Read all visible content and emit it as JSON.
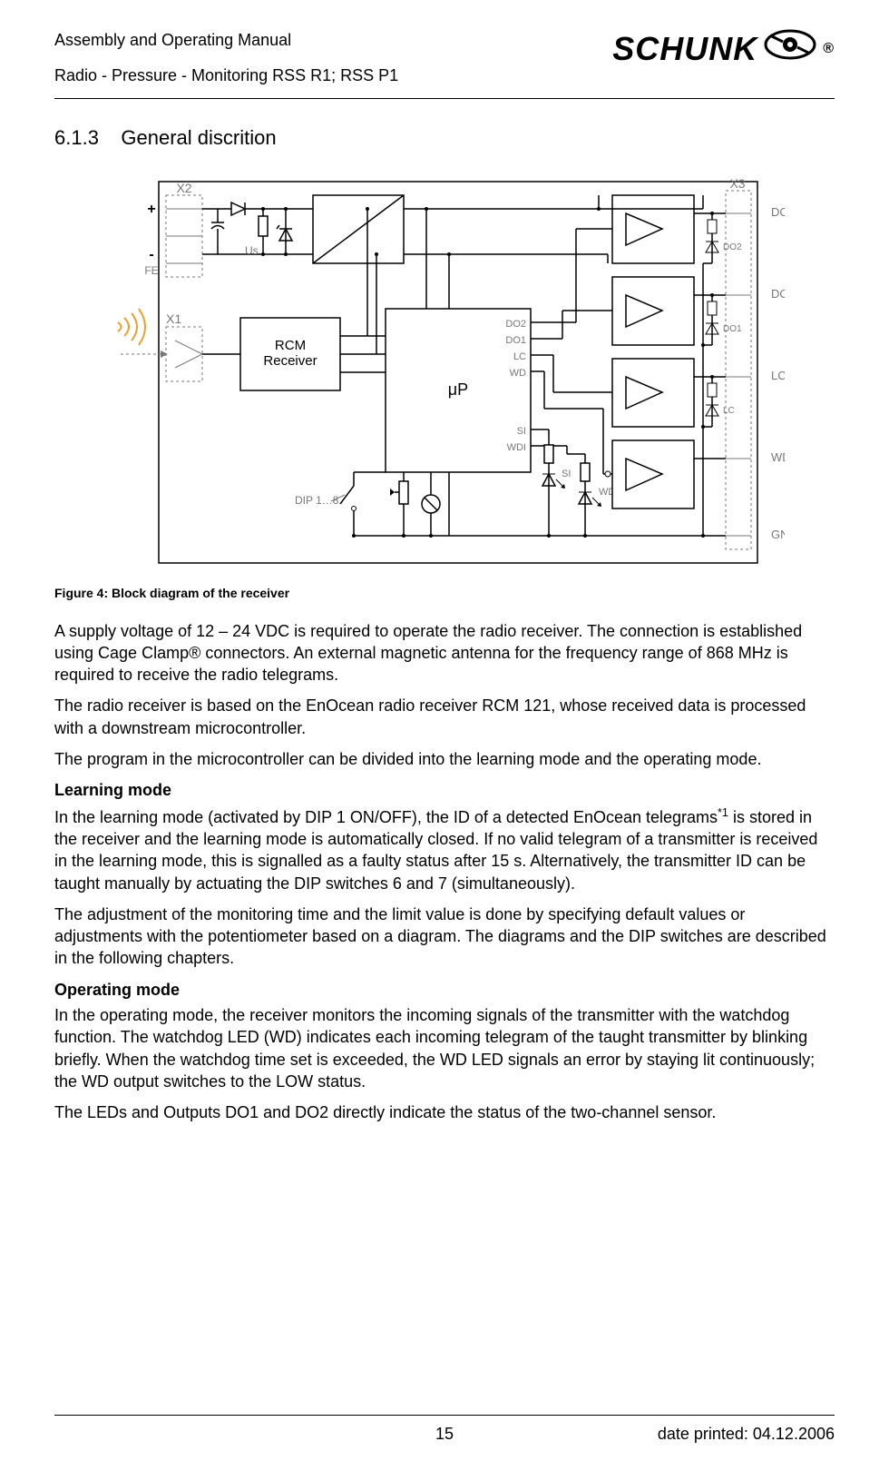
{
  "header": {
    "manual_title": "Assembly and Operating Manual",
    "product_line": "Radio - Pressure - Monitoring RSS R1; RSS P1",
    "brand": "SCHUNK",
    "trademark": "®"
  },
  "section": {
    "number": "6.1.3",
    "title": "General discrition"
  },
  "figure": {
    "caption": "Figure 4: Block diagram of the receiver",
    "labels": {
      "x2": "X2",
      "plus": "+",
      "minus": "-",
      "fe": "FE",
      "x1": "X1",
      "us": "Us",
      "rcm": "RCM",
      "receiver": "Receiver",
      "up": "μP",
      "do2": "DO2",
      "do1": "DO1",
      "lc": "LC",
      "wd": "WD",
      "si": "SI",
      "wdi": "WDI",
      "dip": "DIP 1…8",
      "x3": "X3",
      "gnd": "GND"
    }
  },
  "body": {
    "p1": "A supply voltage of 12 – 24 VDC is required to operate the radio receiver. The connection is established using Cage Clamp® connectors. An external magnetic antenna for the frequency range of 868 MHz is required to receive the radio telegrams.",
    "p2": "The radio receiver is based on the EnOcean radio receiver RCM 121, whose received data is processed with a downstream microcontroller.",
    "p3": "The program in the microcontroller can be divided into the learning mode and the operating mode.",
    "h1": "Learning mode",
    "p4a": "In the learning mode (activated by DIP 1 ON/OFF), the ID of a detected EnOcean telegrams",
    "p4sup": "*1",
    "p4b": " is stored in the receiver and the learning mode is automatically closed. If no valid telegram of a transmitter is received in the learning mode, this is signalled as a faulty status after 15 s. Alternatively, the transmitter ID can be taught manually by actuating the DIP switches 6 and 7 (simultaneously).",
    "p5": "The adjustment of the monitoring time and the limit value is done by specifying default values or adjustments with the potentiometer based on a diagram. The diagrams and the DIP switches are described in the following chapters.",
    "h2": "Operating mode",
    "p6": "In the operating mode, the receiver monitors the incoming signals of the transmitter with the watchdog function. The watchdog LED (WD) indicates each incoming telegram of the taught transmitter by blinking briefly. When the watchdog time set is exceeded, the WD LED signals an error by staying lit continuously; the WD output switches to the LOW status.",
    "p7": "The LEDs and Outputs DO1 and DO2 directly indicate the status of the two-channel sensor."
  },
  "footer": {
    "page": "15",
    "date": "date printed: 04.12.2006"
  }
}
